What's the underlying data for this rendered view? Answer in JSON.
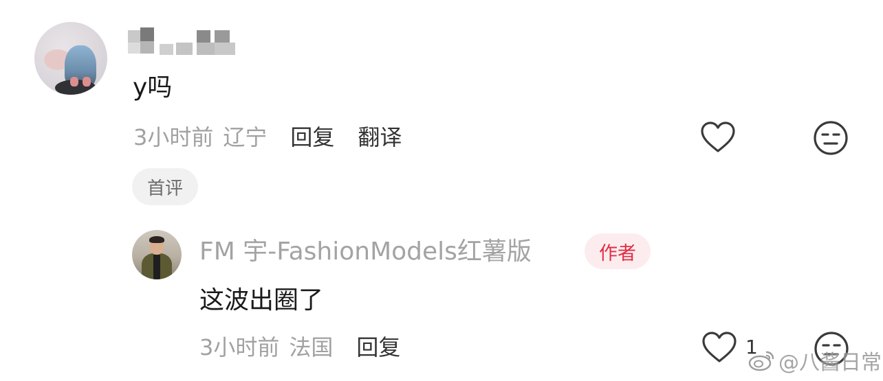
{
  "comment_1": {
    "avatar": "blurred-photo-avatar",
    "username_obscured": true,
    "text": "y吗",
    "time": "3小时前",
    "location": "辽宁",
    "reply_label": "回复",
    "translate_label": "翻译",
    "badge": "首评",
    "like_icon": "heart-outline-icon",
    "dislike_icon": "neutral-face-icon"
  },
  "comment_2": {
    "avatar": "man-in-jacket-avatar",
    "username": "FM 宇-FashionModels红薯版",
    "author_badge": "作者",
    "text": "这波出圈了",
    "time": "3小时前",
    "location": "法国",
    "reply_label": "回复",
    "like_count": "1",
    "like_icon": "heart-outline-icon",
    "dislike_icon": "neutral-face-icon"
  },
  "watermark": {
    "text": "@八酱日常",
    "icon": "weibo-logo-icon"
  },
  "colors": {
    "primary_text": "#1a1a1a",
    "secondary_text": "#a1a1a1",
    "action_text": "#333333",
    "author_badge_text": "#e02e45",
    "author_badge_bg": "#fdecee",
    "first_badge_bg": "#f1f1f1"
  }
}
